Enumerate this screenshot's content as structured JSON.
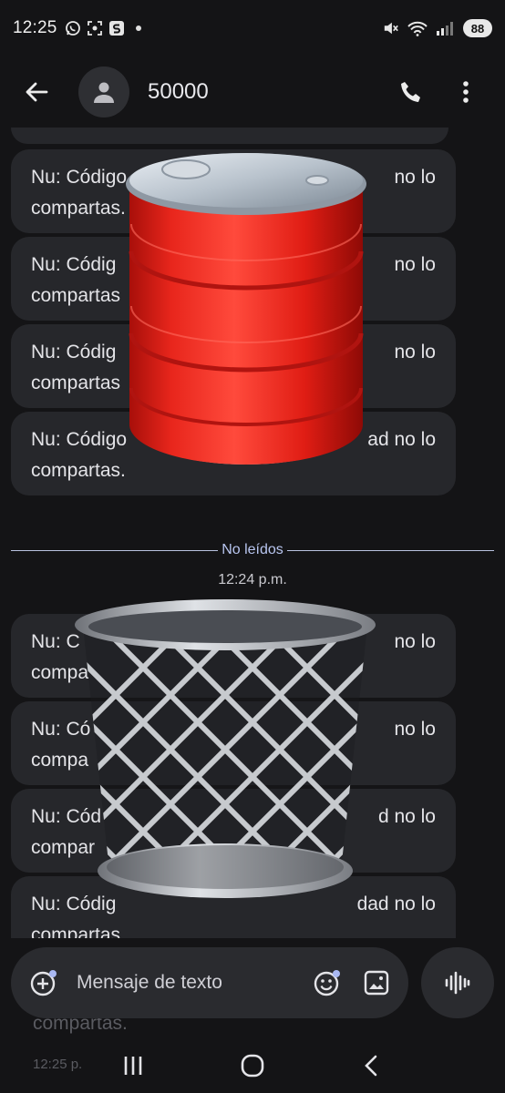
{
  "status_bar": {
    "time": "12:25",
    "battery": "88",
    "signal_tag": "6"
  },
  "header": {
    "contact_name": "50000",
    "icons": [
      "back-arrow-icon",
      "avatar-person-icon",
      "phone-icon",
      "more-vert-icon"
    ]
  },
  "messages": [
    {
      "line1": "Nu: Código",
      "line1_end": "no lo",
      "line2": "compartas."
    },
    {
      "line1": "Nu: Códig",
      "line1_end": "no lo",
      "line2": "compartas"
    },
    {
      "line1": "Nu: Códig",
      "line1_end": "no lo",
      "line2": "compartas"
    },
    {
      "line1": "Nu: Código",
      "line1_end": "ad no lo",
      "line2": "compartas."
    }
  ],
  "unread_divider": "No leídos",
  "unread_time": "12:24 p.m.",
  "unread_messages": [
    {
      "line1": "Nu: C",
      "line1_end": "no lo",
      "line2": "compa"
    },
    {
      "line1": "Nu: Có",
      "line1_end": "no lo",
      "line2": "compa"
    },
    {
      "line1": "Nu: Cód",
      "line1_end": "d no lo",
      "line2": "compar"
    },
    {
      "line1": "Nu: Códig",
      "line1_end": "dad no lo",
      "line2": "compartas."
    }
  ],
  "ghost": {
    "text": "compartas.",
    "time": "12:25 p."
  },
  "composer": {
    "placeholder": "Mensaje de texto"
  },
  "colors": {
    "background": "#141416",
    "bubble": "#26272b",
    "accent": "#b9c6f0"
  }
}
